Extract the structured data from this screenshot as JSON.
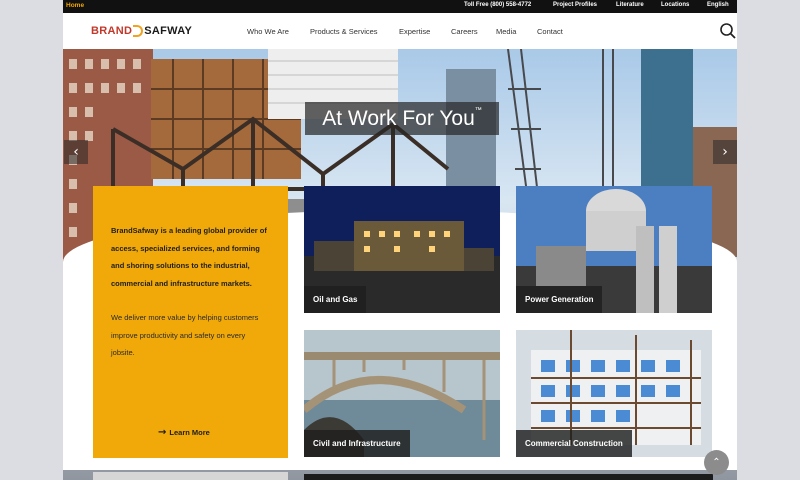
{
  "topbar": {
    "home": "Home",
    "links": [
      "Toll Free (800) 558-4772",
      "Project Profiles",
      "Literature",
      "Locations",
      "English"
    ]
  },
  "header": {
    "logo_brand": "BRAND",
    "logo_safway": "SAFWAY",
    "nav": [
      "Who We Are",
      "Products & Services",
      "Expertise",
      "Careers",
      "Media",
      "Contact"
    ],
    "search_icon": "search-icon"
  },
  "hero": {
    "headline": "At Work For You",
    "trademark": "™",
    "prev_icon": "chevron-left-icon",
    "next_icon": "chevron-right-icon",
    "prev_glyph": "‹",
    "next_glyph": "›"
  },
  "intro": {
    "lead": "BrandSafway is a leading global provider of access, specialized services, and forming and shoring solutions to the industrial, commercial and infrastructure markets.",
    "sub": "We deliver more value by helping customers improve productivity and safety on every jobsite.",
    "learn_more": "Learn More",
    "learn_arrow": "→"
  },
  "tiles": [
    {
      "label": "Oil and Gas"
    },
    {
      "label": "Power Generation"
    },
    {
      "label": "Civil and Infrastructure"
    },
    {
      "label": "Commercial Construction"
    }
  ],
  "scroll_top": {
    "icon": "chevron-up-icon",
    "glyph": "⌃"
  },
  "colors": {
    "accent_yellow": "#f1a90a",
    "topbar": "#111111",
    "brand_red": "#c2382a"
  }
}
